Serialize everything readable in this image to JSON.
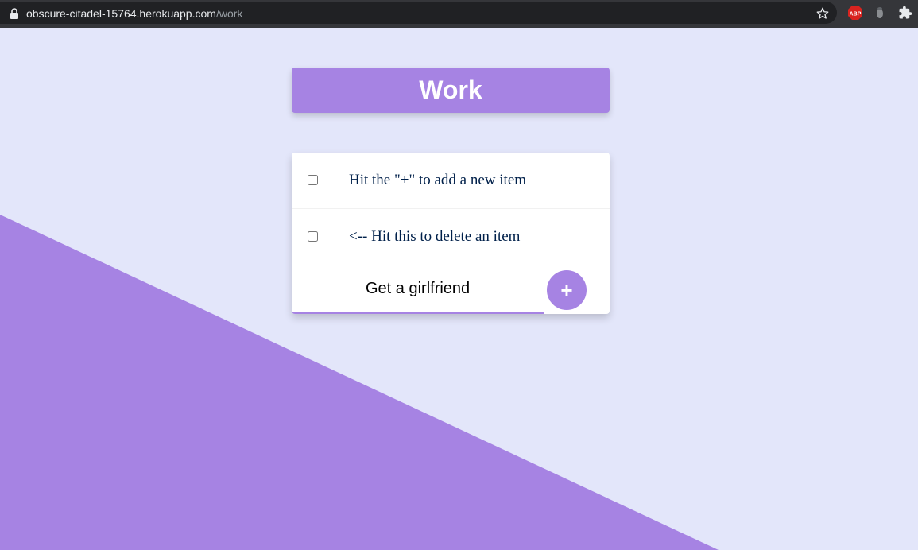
{
  "browser": {
    "url_host": "obscure-citadel-15764.herokuapp.com",
    "url_path": "/work",
    "icons": [
      "lock-icon",
      "star-icon",
      "adblock-plus-icon",
      "extension-icon",
      "puzzle-icon"
    ],
    "abp_label": "ABP"
  },
  "heading": {
    "title": "Work"
  },
  "list": {
    "items": [
      {
        "label": "Hit the \"+\" to add a new item",
        "checked": false
      },
      {
        "label": "<-- Hit this to delete an item",
        "checked": false
      }
    ]
  },
  "form": {
    "new_item_value": "Get a girlfriend",
    "add_button_label": "+"
  },
  "colors": {
    "accent": "#a683e3",
    "background": "#e3e6fa",
    "item_text": "#00204a",
    "chrome_bar": "#35363a"
  }
}
